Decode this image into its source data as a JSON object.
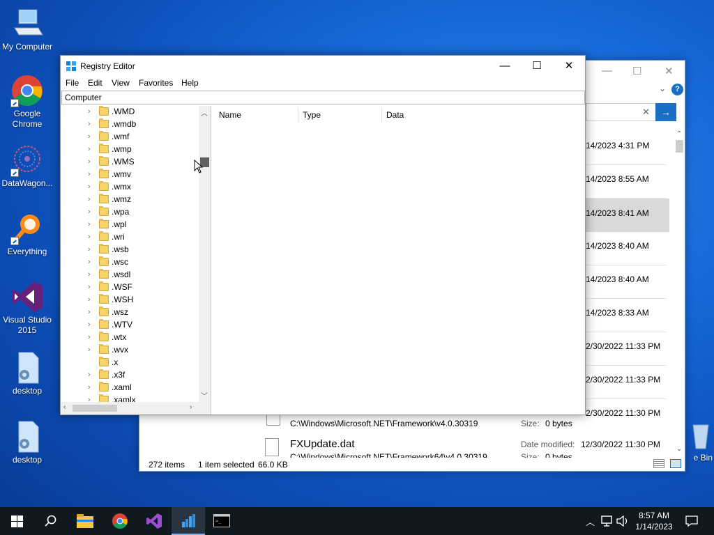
{
  "desktop": {
    "icons": [
      {
        "label": "My Computer"
      },
      {
        "label": "Google Chrome"
      },
      {
        "label": "DataWagon..."
      },
      {
        "label": "Everything"
      },
      {
        "label": "Visual Studio 2015"
      },
      {
        "label": "desktop"
      },
      {
        "label": "desktop"
      },
      {
        "label": "e Bin"
      }
    ]
  },
  "explorer": {
    "dates": [
      "14/2023 4:31 PM",
      "14/2023 8:55 AM",
      "14/2023 8:41 AM",
      "14/2023 8:40 AM",
      "14/2023 8:40 AM",
      "14/2023 8:33 AM",
      "2/30/2022 11:33 PM",
      "2/30/2022 11:33 PM",
      "2/30/2022 11:30 PM"
    ],
    "file1_path": "C:\\Windows\\Microsoft.NET\\Framework\\v4.0.30319",
    "file1_size_label": "Size:",
    "file1_size": "0 bytes",
    "file2_name": "FXUpdate.dat",
    "file2_path": "C:\\Windows\\Microsoft.NET\\Framework64\\v4.0.30319",
    "file2_modified_label": "Date modified:",
    "file2_modified": "12/30/2022 11:30 PM",
    "file2_size_label": "Size:",
    "file2_size": "0 bytes",
    "status_items": "272 items",
    "status_selected": "1 item selected",
    "status_size": "66.0 KB"
  },
  "regedit": {
    "title": "Registry Editor",
    "menu": [
      "File",
      "Edit",
      "View",
      "Favorites",
      "Help"
    ],
    "address": "Computer",
    "tree_items": [
      ".WMD",
      ".wmdb",
      ".wmf",
      ".wmp",
      ".WMS",
      ".wmv",
      ".wmx",
      ".wmz",
      ".wpa",
      ".wpl",
      ".wri",
      ".wsb",
      ".wsc",
      ".wsdl",
      ".WSF",
      ".WSH",
      ".wsz",
      ".WTV",
      ".wtx",
      ".wvx",
      ".x",
      ".x3f",
      ".xaml",
      ".xamlx"
    ],
    "columns": [
      "Name",
      "Type",
      "Data"
    ]
  },
  "taskbar": {
    "time": "8:57 AM",
    "date": "1/14/2023"
  },
  "colors": {
    "accent": "#0078d7",
    "taskbar": "#101820",
    "folder": "#f6d46a"
  }
}
